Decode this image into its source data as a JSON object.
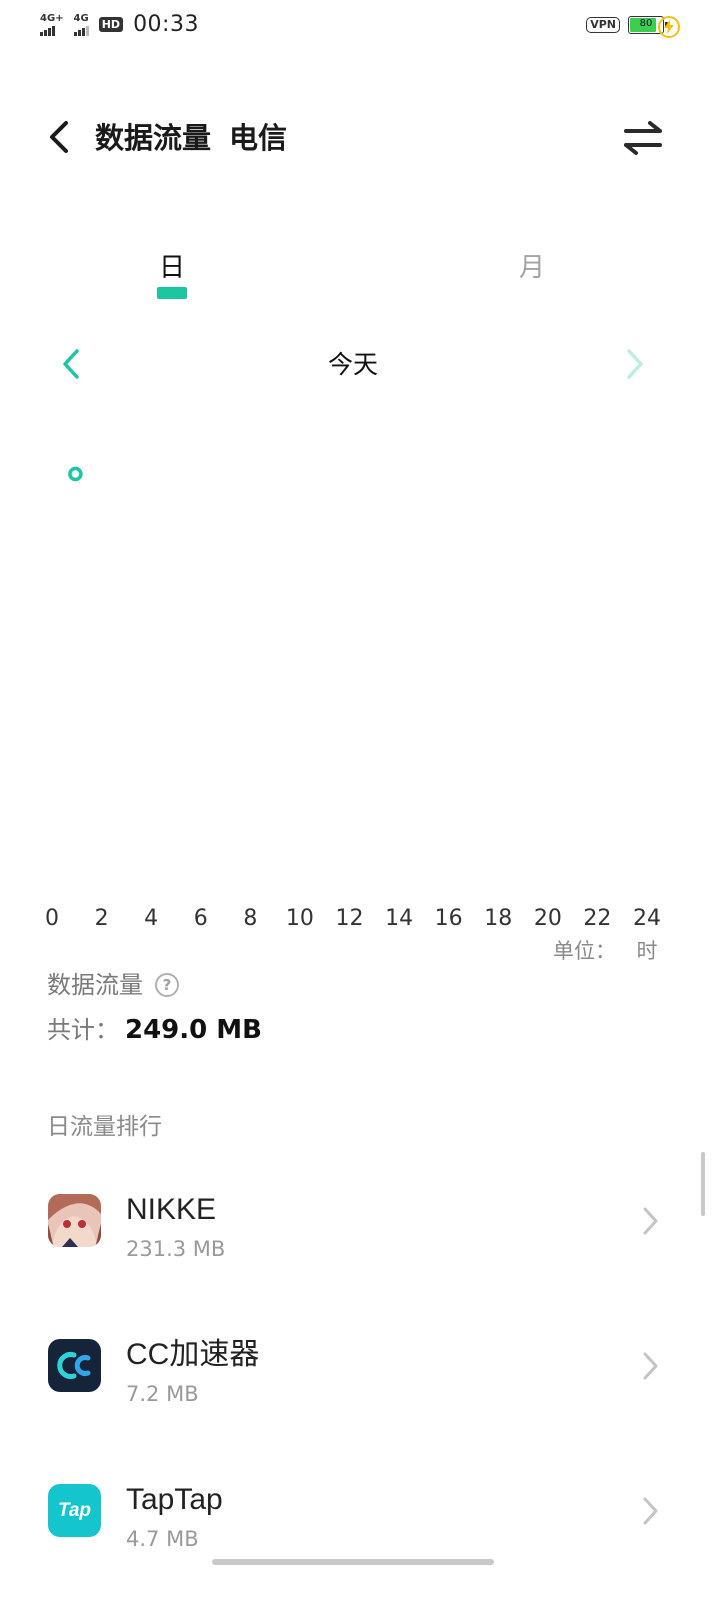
{
  "status_bar": {
    "sim1_network": "4G+",
    "sim2_network": "4G",
    "hd_label": "HD",
    "time": "00:33",
    "vpn_label": "VPN",
    "battery_level": "80",
    "battery_color": "#3ccf4e",
    "charging_icon": "charging-bolt-icon"
  },
  "header": {
    "title": "数据流量",
    "carrier": "电信",
    "back_icon": "back-arrow-icon",
    "switch_icon": "switch-sim-icon"
  },
  "tabs": {
    "day_label": "日",
    "month_label": "月",
    "active": "日",
    "accent_color": "#1cc6a2"
  },
  "date_nav": {
    "label": "今天",
    "prev_icon": "chevron-left-icon",
    "next_icon": "chevron-right-icon"
  },
  "chart_data": {
    "type": "line",
    "x_ticks": [
      "0",
      "2",
      "4",
      "6",
      "8",
      "10",
      "12",
      "14",
      "16",
      "18",
      "20",
      "22",
      "24"
    ],
    "xlim": [
      0,
      24
    ],
    "points": [
      {
        "x": 0.5
      }
    ],
    "unit_label": "单位：",
    "unit_value": "时"
  },
  "summary": {
    "title": "数据流量",
    "help_icon": "help-icon",
    "total_label": "共计：",
    "total_value": "249.0  MB"
  },
  "ranking": {
    "title": "日流量排行",
    "apps": [
      {
        "name": "NIKKE",
        "usage": "231.3  MB",
        "icon": "nikke-app-icon"
      },
      {
        "name": "CC加速器",
        "usage": "7.2  MB",
        "icon": "cc-accelerator-app-icon"
      },
      {
        "name": "TapTap",
        "usage": "4.7  MB",
        "icon": "taptap-app-icon",
        "icon_text": "Tap"
      }
    ]
  }
}
